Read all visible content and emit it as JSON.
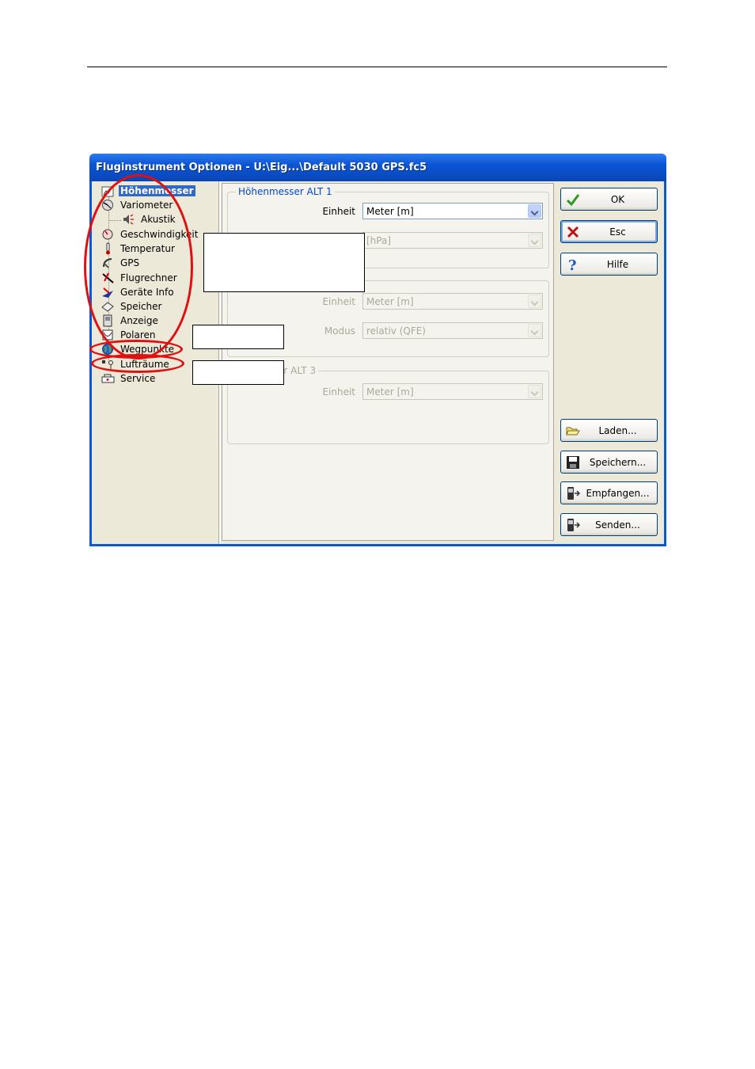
{
  "window": {
    "title": "Fluginstrument Optionen - U:\\Eig...\\Default 5030 GPS.fc5"
  },
  "tree": {
    "items": [
      {
        "label": "Höhenmesser",
        "icon": "altimeter-icon",
        "selected": true
      },
      {
        "label": "Variometer",
        "icon": "variometer-icon"
      },
      {
        "label": "Akustik",
        "icon": "speaker-icon",
        "child": true
      },
      {
        "label": "Geschwindigkeit",
        "icon": "speed-gauge-icon"
      },
      {
        "label": "Temperatur",
        "icon": "thermometer-icon"
      },
      {
        "label": "GPS",
        "icon": "satellite-icon"
      },
      {
        "label": "Flugrechner",
        "icon": "flight-computer-icon"
      },
      {
        "label": "Geräte Info",
        "icon": "device-info-icon"
      },
      {
        "label": "Speicher",
        "icon": "memory-icon"
      },
      {
        "label": "Anzeige",
        "icon": "display-icon"
      },
      {
        "label": "Polaren",
        "icon": "polar-icon"
      },
      {
        "label": "Wegpunkte",
        "icon": "globe-icon"
      },
      {
        "label": "Lufträume",
        "icon": "airspace-icon"
      },
      {
        "label": "Service",
        "icon": "service-icon"
      }
    ]
  },
  "groups": {
    "alt1": {
      "title": "Höhenmesser ALT 1",
      "einheit_label": "Einheit",
      "einheit_value": "Meter [m]",
      "second_value": "[hPa]"
    },
    "alt2": {
      "einheit_label": "Einheit",
      "einheit_value": "Meter [m]",
      "modus_label": "Modus",
      "modus_value": "relativ (QFE)"
    },
    "alt3": {
      "title_partial": "er ALT 3",
      "einheit_label": "Einheit",
      "einheit_value": "Meter [m]"
    }
  },
  "buttons": {
    "ok": "OK",
    "esc": "Esc",
    "hilfe": "Hilfe",
    "laden": "Laden...",
    "speichern": "Speichern...",
    "empfangen": "Empfangen...",
    "senden": "Senden..."
  },
  "colors": {
    "titlebar": "#0b55d4",
    "selection": "#316ac5",
    "annotation": "#e01010",
    "group_title": "#0046d5"
  }
}
